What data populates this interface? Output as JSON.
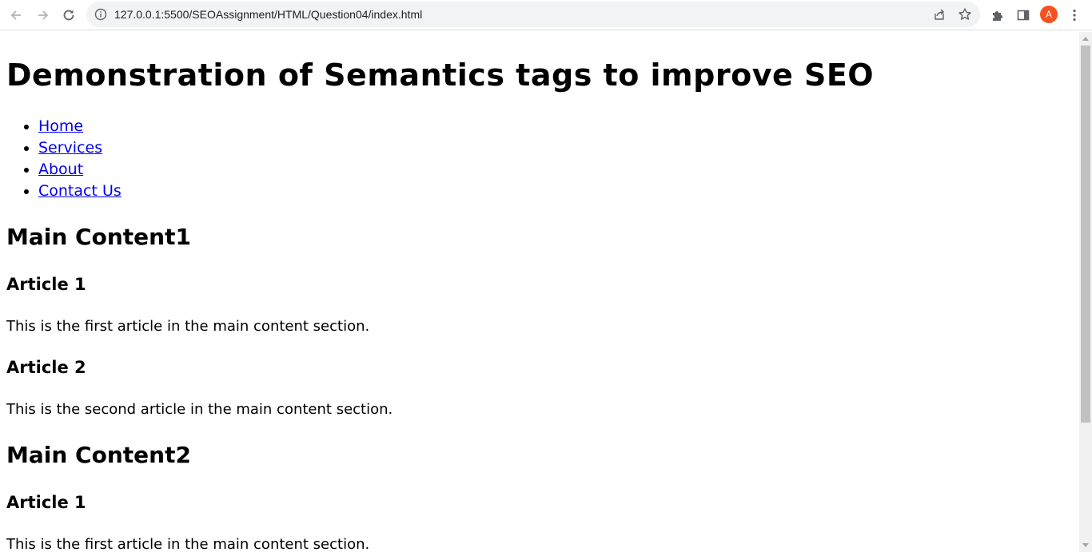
{
  "browser": {
    "url": "127.0.0.1:5500/SEOAssignment/HTML/Question04/index.html",
    "avatar_letter": "A",
    "avatar_color": "#f4511e"
  },
  "page": {
    "heading": "Demonstration of Semantics tags to improve SEO",
    "nav": [
      "Home",
      "Services",
      "About",
      "Contact Us"
    ],
    "sections": [
      {
        "title": "Main Content1",
        "articles": [
          {
            "title": "Article 1",
            "text": "This is the first article in the main content section."
          },
          {
            "title": "Article 2",
            "text": "This is the second article in the main content section."
          }
        ]
      },
      {
        "title": "Main Content2",
        "articles": [
          {
            "title": "Article 1",
            "text": "This is the first article in the main content section."
          }
        ]
      }
    ]
  },
  "colors": {
    "link": "#0000ee",
    "toolbar_bg": "#ffffff",
    "omnibox_bg": "#f1f3f4"
  }
}
